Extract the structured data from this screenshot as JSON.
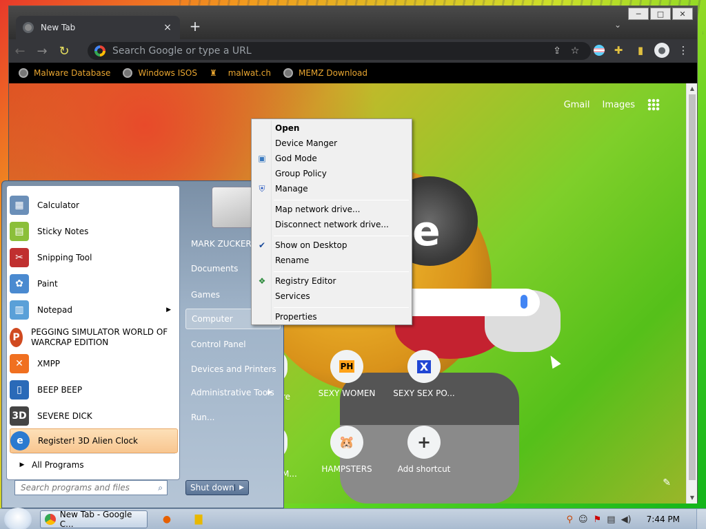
{
  "browser": {
    "tab_title": "New Tab",
    "tab_close": "×",
    "new_tab": "+",
    "omnibox_placeholder": "Search Google or type a URL",
    "window_controls": [
      "─",
      "□",
      "✕"
    ],
    "bookmarks": [
      {
        "label": "Malware Database",
        "icon": "globe-icon"
      },
      {
        "label": "Windows ISOS",
        "icon": "globe-icon"
      },
      {
        "label": "malwat.ch",
        "icon": "warning-icon"
      },
      {
        "label": "MEMZ Download",
        "icon": "globe-icon"
      }
    ]
  },
  "newtab": {
    "gmail": "Gmail",
    "images": "Images",
    "logo_fragment": "e",
    "shortcuts": [
      {
        "label": "SEXY WOMEN",
        "icon_text": "PH"
      },
      {
        "label": "SEXY SEX PO...",
        "icon_text": "X"
      },
      {
        "label": "HAMPSTERS",
        "icon_text": "🐹"
      },
      {
        "label": "Add shortcut",
        "icon_text": "+"
      }
    ],
    "partial_labels": [
      "re",
      "M..."
    ]
  },
  "startmenu": {
    "programs": [
      {
        "label": "Calculator",
        "icon": "calculator-icon",
        "color": "#6b8fb8"
      },
      {
        "label": "Sticky Notes",
        "icon": "sticky-notes-icon",
        "color": "#8bbf3a"
      },
      {
        "label": "Snipping Tool",
        "icon": "scissors-icon",
        "color": "#c03030"
      },
      {
        "label": "Paint",
        "icon": "palette-icon",
        "color": "#4a8ad0"
      },
      {
        "label": "Notepad",
        "icon": "notepad-icon",
        "color": "#5aa0d8"
      },
      {
        "label": "PEGGING SIMULATOR WORLD OF WARCRAP EDITION",
        "icon": "game-icon",
        "color": "#d04a20"
      },
      {
        "label": "XMPP",
        "icon": "xmpp-icon",
        "color": "#f07020"
      },
      {
        "label": "BEEP BEEP",
        "icon": "phone-icon",
        "color": "#2a6ab8"
      },
      {
        "label": "SEVERE DICK",
        "icon": "3d-icon",
        "color": "#444"
      },
      {
        "label": "Register! 3D Alien Clock",
        "icon": "ie-icon",
        "color": "#2a7ad0"
      }
    ],
    "all_programs": "All Programs",
    "search_placeholder": "Search programs and files",
    "right_links": [
      "MARK ZUCKERBERG",
      "Documents",
      "Games",
      "Computer",
      "Control Panel",
      "Devices and Printers",
      "Administrative Tools",
      "Run..."
    ],
    "shutdown": "Shut down"
  },
  "context_menu": {
    "items": [
      {
        "label": "Open",
        "bold": true
      },
      {
        "label": "Device Manger"
      },
      {
        "label": "God Mode",
        "icon": "monitor-icon"
      },
      {
        "label": "Group Policy"
      },
      {
        "label": "Manage",
        "icon": "shield-icon"
      },
      {
        "label": "Map network drive..."
      },
      {
        "label": "Disconnect network drive..."
      },
      {
        "label": "Show on Desktop",
        "icon": "checkmark-icon"
      },
      {
        "label": "Rename"
      },
      {
        "label": "Registry Editor",
        "icon": "registry-icon"
      },
      {
        "label": "Services"
      },
      {
        "label": "Properties"
      }
    ]
  },
  "taskbar": {
    "chrome_button": "New Tab - Google C...",
    "clock": "7:44 PM"
  }
}
